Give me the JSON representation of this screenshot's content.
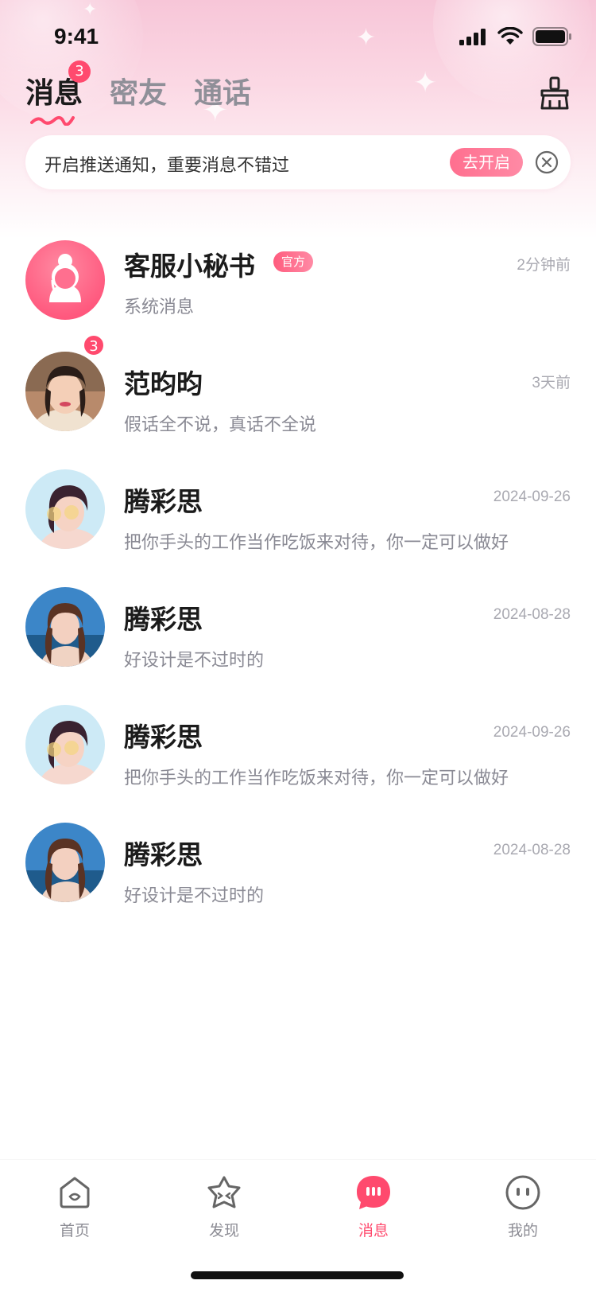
{
  "status_bar": {
    "time": "9:41"
  },
  "top_tabs": [
    {
      "label": "消息",
      "badge": "3",
      "active": true
    },
    {
      "label": "密友",
      "active": false
    },
    {
      "label": "通话",
      "active": false
    }
  ],
  "notify_banner": {
    "text": "开启推送通知，重要消息不错过",
    "enable_label": "去开启"
  },
  "messages": [
    {
      "name": "客服小秘书",
      "tag": "官方",
      "time": "2分钟前",
      "preview": "系统消息",
      "avatar": "service-avatar"
    },
    {
      "name": "范昀昀",
      "badge": "3",
      "time": "3天前",
      "preview": "假话全不说，真话不全说",
      "avatar": "user-photo"
    },
    {
      "name": "腾彩思",
      "time": "2024-09-26",
      "preview": "把你手头的工作当作吃饭来对待，你一定可以做好",
      "avatar": "user-photo"
    },
    {
      "name": "腾彩思",
      "time": "2024-08-28",
      "preview": "好设计是不过时的",
      "avatar": "user-photo"
    },
    {
      "name": "腾彩思",
      "time": "2024-09-26",
      "preview": "把你手头的工作当作吃饭来对待，你一定可以做好",
      "avatar": "user-photo"
    },
    {
      "name": "腾彩思",
      "time": "2024-08-28",
      "preview": "好设计是不过时的",
      "avatar": "user-photo"
    }
  ],
  "bottom_nav": [
    {
      "label": "首页",
      "icon": "home-icon",
      "active": false
    },
    {
      "label": "发现",
      "icon": "discover-icon",
      "active": false
    },
    {
      "label": "消息",
      "icon": "message-icon",
      "active": true
    },
    {
      "label": "我的",
      "icon": "profile-icon",
      "active": false
    }
  ],
  "colors": {
    "accent": "#ff4a6e",
    "hero_pink": "#f7c6d8",
    "text_primary": "#1b1b1b",
    "text_secondary": "#8a8a94"
  }
}
